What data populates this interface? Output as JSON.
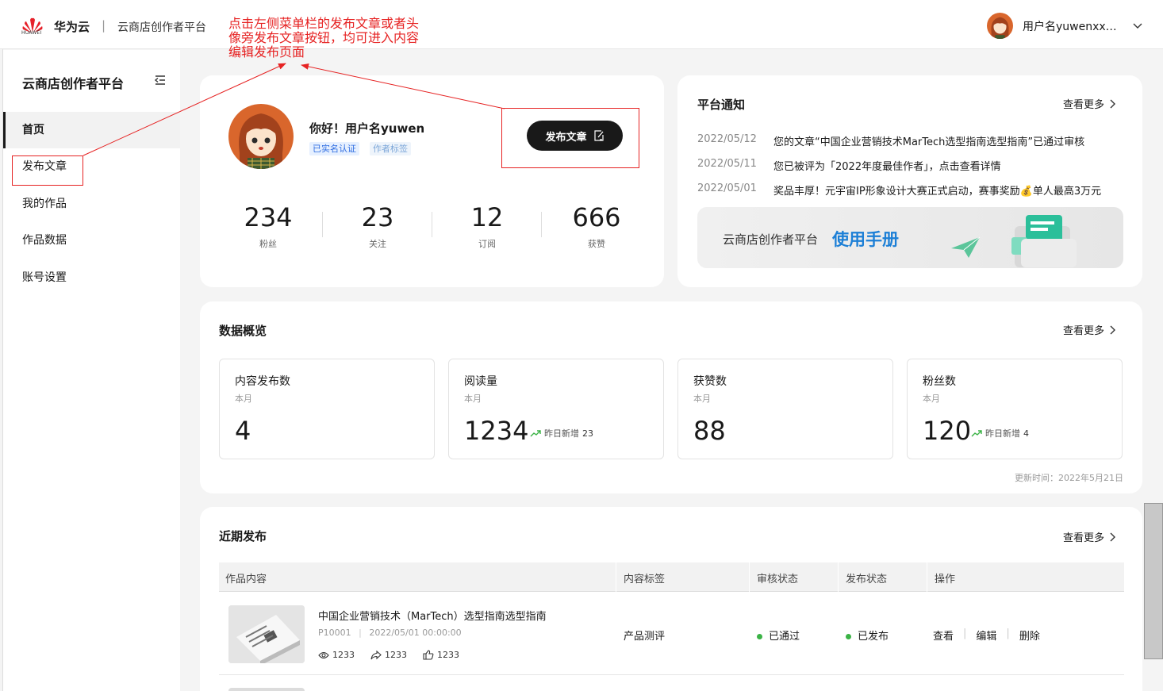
{
  "topbar": {
    "logo_text": "HUAWEI",
    "brand": "华为云",
    "separator": "|",
    "platform": "云商店创作者平台",
    "user_name": "用户名yuwenxxxxxxxx"
  },
  "sidebar": {
    "title": "云商店创作者平台",
    "items": [
      {
        "label": "首页",
        "active": true
      },
      {
        "label": "发布文章",
        "active": false
      },
      {
        "label": "我的作品",
        "active": false
      },
      {
        "label": "作品数据",
        "active": false
      },
      {
        "label": "账号设置",
        "active": false
      }
    ]
  },
  "annotation": {
    "text": "点击左侧菜单栏的发布文章或者头像旁发布文章按钮，均可进入内容编辑发布页面"
  },
  "profile": {
    "greeting": "你好！用户名yuwen",
    "tags": [
      "已实名认证",
      "作者标签"
    ],
    "publish_button": "发布文章",
    "stats": [
      {
        "value": "234",
        "label": "粉丝"
      },
      {
        "value": "23",
        "label": "关注"
      },
      {
        "value": "12",
        "label": "订阅"
      },
      {
        "value": "666",
        "label": "获赞"
      }
    ]
  },
  "notices": {
    "title": "平台通知",
    "more": "查看更多",
    "items": [
      {
        "date": "2022/05/12",
        "text": "您的文章“中国企业营销技术MarTech选型指南选型指南”已通过审核"
      },
      {
        "date": "2022/05/11",
        "text": "您已被评为「2022年度最佳作者」，点击查看详情"
      },
      {
        "date": "2022/05/01",
        "text": "奖品丰厚！元宇宙IP形象设计大赛正式启动，赛事奖励💰单人最高3万元"
      }
    ],
    "banner_text": "云商店创作者平台",
    "banner_highlight": "使用手册"
  },
  "overview": {
    "title": "数据概览",
    "more": "查看更多",
    "cards": [
      {
        "title": "内容发布数",
        "sub": "本月",
        "value": "4",
        "inc_label": "",
        "inc_value": ""
      },
      {
        "title": "阅读量",
        "sub": "本月",
        "value": "1234",
        "inc_label": "昨日新增",
        "inc_value": "23"
      },
      {
        "title": "获赞数",
        "sub": "本月",
        "value": "88",
        "inc_label": "",
        "inc_value": ""
      },
      {
        "title": "粉丝数",
        "sub": "本月",
        "value": "120",
        "inc_label": "昨日新增",
        "inc_value": "4"
      }
    ],
    "updated": "更新时间：2022年5月21日"
  },
  "recent": {
    "title": "近期发布",
    "more": "查看更多",
    "columns": [
      "作品内容",
      "内容标签",
      "审核状态",
      "发布状态",
      "操作"
    ],
    "rows": [
      {
        "title": "中国企业营销技术（MarTech）选型指南选型指南",
        "id": "P10001",
        "meta_sep": "|",
        "datetime": "2022/05/01 00:00:00",
        "views": "1233",
        "shares": "1233",
        "likes": "1233",
        "tag": "产品测评",
        "review": "已通过",
        "publish": "已发布",
        "ops": [
          "查看",
          "编辑",
          "删除"
        ]
      }
    ]
  },
  "colors": {
    "accent": "#1c7fd6",
    "annotation": "#e62222",
    "status_green": "#3bb346",
    "dark": "#191919"
  }
}
